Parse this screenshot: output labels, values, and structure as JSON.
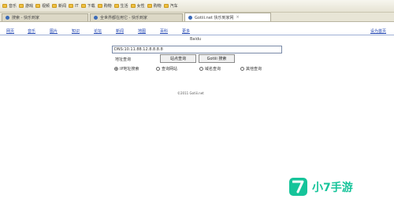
{
  "bookmarks": [
    "音乐",
    "游戏",
    "视频",
    "新闻",
    "IT",
    "下载",
    "购物",
    "生活",
    "女性",
    "购物",
    "汽车"
  ],
  "tabs": [
    {
      "label": "搜索 - 快乐到家",
      "active": false
    },
    {
      "label": "全世界都在用它 - 快乐到家",
      "active": false
    },
    {
      "label": "Gotiii.net 快乐到家网",
      "active": true
    }
  ],
  "nav": {
    "items": [
      "网页",
      "音乐",
      "图片",
      "知识",
      "论坛",
      "新闻",
      "地图",
      "百科",
      "更多"
    ],
    "right_link": "设为首页"
  },
  "logo_text": "Baidu",
  "search": {
    "value": "DNS:10.11.88.12.8.8.8.8"
  },
  "buttons": {
    "label_left": "地址查询",
    "btn1": "站点查询",
    "btn2": "Gotiii 搜索"
  },
  "radios": [
    {
      "label": "IP地址搜索",
      "checked": true
    },
    {
      "label": "查询网站",
      "checked": false
    },
    {
      "label": "域名查询",
      "checked": false
    },
    {
      "label": "其他查询",
      "checked": false
    }
  ],
  "footer_text": "©2011 Gotiii.net",
  "watermark": {
    "text": "小7手游"
  },
  "colors": {
    "link": "#1a3fb0",
    "watermark": "#16c49a"
  }
}
